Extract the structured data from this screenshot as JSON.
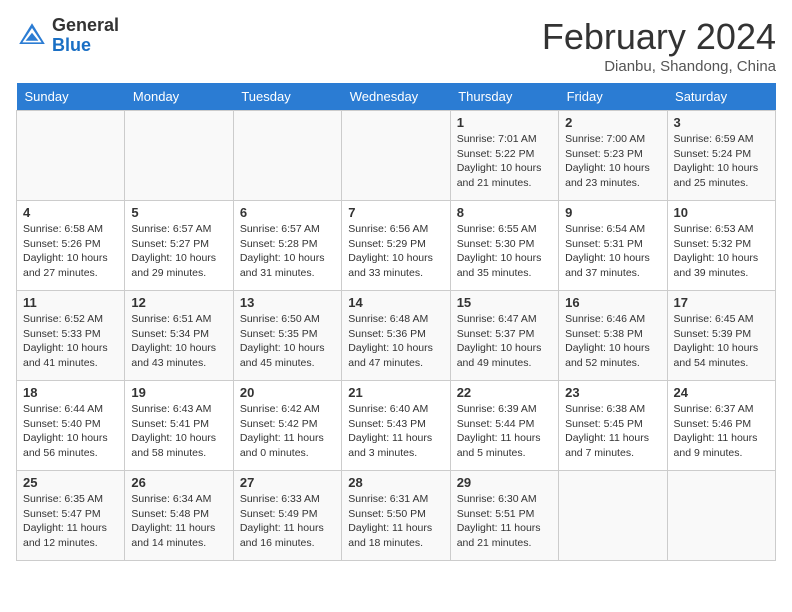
{
  "header": {
    "logo_general": "General",
    "logo_blue": "Blue",
    "month_year": "February 2024",
    "location": "Dianbu, Shandong, China"
  },
  "days_of_week": [
    "Sunday",
    "Monday",
    "Tuesday",
    "Wednesday",
    "Thursday",
    "Friday",
    "Saturday"
  ],
  "weeks": [
    [
      {
        "day": "",
        "info": ""
      },
      {
        "day": "",
        "info": ""
      },
      {
        "day": "",
        "info": ""
      },
      {
        "day": "",
        "info": ""
      },
      {
        "day": "1",
        "info": "Sunrise: 7:01 AM\nSunset: 5:22 PM\nDaylight: 10 hours\nand 21 minutes."
      },
      {
        "day": "2",
        "info": "Sunrise: 7:00 AM\nSunset: 5:23 PM\nDaylight: 10 hours\nand 23 minutes."
      },
      {
        "day": "3",
        "info": "Sunrise: 6:59 AM\nSunset: 5:24 PM\nDaylight: 10 hours\nand 25 minutes."
      }
    ],
    [
      {
        "day": "4",
        "info": "Sunrise: 6:58 AM\nSunset: 5:26 PM\nDaylight: 10 hours\nand 27 minutes."
      },
      {
        "day": "5",
        "info": "Sunrise: 6:57 AM\nSunset: 5:27 PM\nDaylight: 10 hours\nand 29 minutes."
      },
      {
        "day": "6",
        "info": "Sunrise: 6:57 AM\nSunset: 5:28 PM\nDaylight: 10 hours\nand 31 minutes."
      },
      {
        "day": "7",
        "info": "Sunrise: 6:56 AM\nSunset: 5:29 PM\nDaylight: 10 hours\nand 33 minutes."
      },
      {
        "day": "8",
        "info": "Sunrise: 6:55 AM\nSunset: 5:30 PM\nDaylight: 10 hours\nand 35 minutes."
      },
      {
        "day": "9",
        "info": "Sunrise: 6:54 AM\nSunset: 5:31 PM\nDaylight: 10 hours\nand 37 minutes."
      },
      {
        "day": "10",
        "info": "Sunrise: 6:53 AM\nSunset: 5:32 PM\nDaylight: 10 hours\nand 39 minutes."
      }
    ],
    [
      {
        "day": "11",
        "info": "Sunrise: 6:52 AM\nSunset: 5:33 PM\nDaylight: 10 hours\nand 41 minutes."
      },
      {
        "day": "12",
        "info": "Sunrise: 6:51 AM\nSunset: 5:34 PM\nDaylight: 10 hours\nand 43 minutes."
      },
      {
        "day": "13",
        "info": "Sunrise: 6:50 AM\nSunset: 5:35 PM\nDaylight: 10 hours\nand 45 minutes."
      },
      {
        "day": "14",
        "info": "Sunrise: 6:48 AM\nSunset: 5:36 PM\nDaylight: 10 hours\nand 47 minutes."
      },
      {
        "day": "15",
        "info": "Sunrise: 6:47 AM\nSunset: 5:37 PM\nDaylight: 10 hours\nand 49 minutes."
      },
      {
        "day": "16",
        "info": "Sunrise: 6:46 AM\nSunset: 5:38 PM\nDaylight: 10 hours\nand 52 minutes."
      },
      {
        "day": "17",
        "info": "Sunrise: 6:45 AM\nSunset: 5:39 PM\nDaylight: 10 hours\nand 54 minutes."
      }
    ],
    [
      {
        "day": "18",
        "info": "Sunrise: 6:44 AM\nSunset: 5:40 PM\nDaylight: 10 hours\nand 56 minutes."
      },
      {
        "day": "19",
        "info": "Sunrise: 6:43 AM\nSunset: 5:41 PM\nDaylight: 10 hours\nand 58 minutes."
      },
      {
        "day": "20",
        "info": "Sunrise: 6:42 AM\nSunset: 5:42 PM\nDaylight: 11 hours\nand 0 minutes."
      },
      {
        "day": "21",
        "info": "Sunrise: 6:40 AM\nSunset: 5:43 PM\nDaylight: 11 hours\nand 3 minutes."
      },
      {
        "day": "22",
        "info": "Sunrise: 6:39 AM\nSunset: 5:44 PM\nDaylight: 11 hours\nand 5 minutes."
      },
      {
        "day": "23",
        "info": "Sunrise: 6:38 AM\nSunset: 5:45 PM\nDaylight: 11 hours\nand 7 minutes."
      },
      {
        "day": "24",
        "info": "Sunrise: 6:37 AM\nSunset: 5:46 PM\nDaylight: 11 hours\nand 9 minutes."
      }
    ],
    [
      {
        "day": "25",
        "info": "Sunrise: 6:35 AM\nSunset: 5:47 PM\nDaylight: 11 hours\nand 12 minutes."
      },
      {
        "day": "26",
        "info": "Sunrise: 6:34 AM\nSunset: 5:48 PM\nDaylight: 11 hours\nand 14 minutes."
      },
      {
        "day": "27",
        "info": "Sunrise: 6:33 AM\nSunset: 5:49 PM\nDaylight: 11 hours\nand 16 minutes."
      },
      {
        "day": "28",
        "info": "Sunrise: 6:31 AM\nSunset: 5:50 PM\nDaylight: 11 hours\nand 18 minutes."
      },
      {
        "day": "29",
        "info": "Sunrise: 6:30 AM\nSunset: 5:51 PM\nDaylight: 11 hours\nand 21 minutes."
      },
      {
        "day": "",
        "info": ""
      },
      {
        "day": "",
        "info": ""
      }
    ]
  ]
}
